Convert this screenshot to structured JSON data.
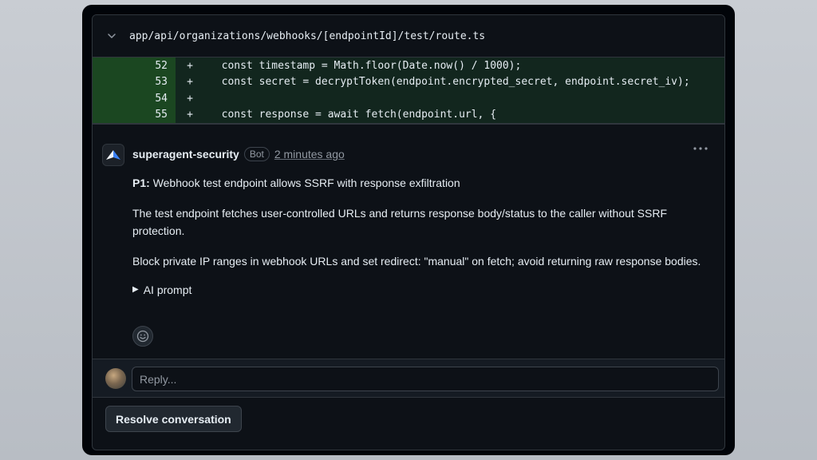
{
  "file": {
    "path": "app/api/organizations/webhooks/[endpointId]/test/route.ts"
  },
  "diff": {
    "lines": [
      {
        "number": "52",
        "sign": "+",
        "code": "  const timestamp = Math.floor(Date.now() / 1000);"
      },
      {
        "number": "53",
        "sign": "+",
        "code": "  const secret = decryptToken(endpoint.encrypted_secret, endpoint.secret_iv);"
      },
      {
        "number": "54",
        "sign": "+",
        "code": ""
      },
      {
        "number": "55",
        "sign": "+",
        "code": "  const response = await fetch(endpoint.url, {"
      }
    ]
  },
  "comment": {
    "author": "superagent-security",
    "badge": "Bot",
    "time": "2 minutes ago",
    "priority": "P1:",
    "title": "Webhook test endpoint allows SSRF with response exfiltration",
    "paragraph1": "The test endpoint fetches user-controlled URLs and returns response body/status to the caller without SSRF protection.",
    "paragraph2": "Block private IP ranges in webhook URLs and set redirect: \"manual\" on fetch; avoid returning raw response bodies.",
    "ai_prompt_label": "AI prompt"
  },
  "reply": {
    "placeholder": "Reply..."
  },
  "actions": {
    "resolve_label": "Resolve conversation"
  },
  "colors": {
    "diff_bg": "#12261e",
    "line_number_bg": "#1b4721",
    "panel_bg": "#0d1117"
  }
}
